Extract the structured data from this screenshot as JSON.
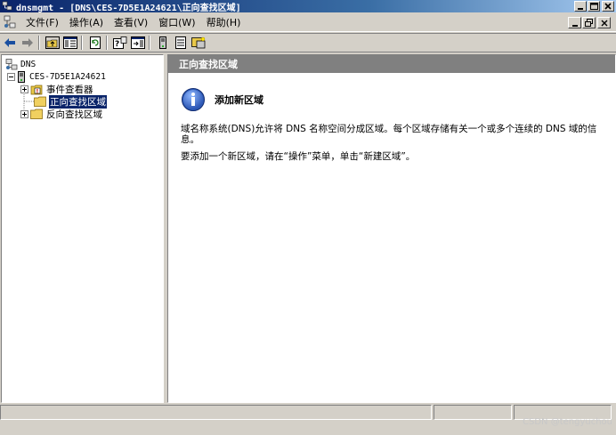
{
  "window": {
    "title": "dnsmgmt - [DNS\\CES-7D5E1A24621\\正向查找区域]"
  },
  "menu": {
    "items": [
      "文件(F)",
      "操作(A)",
      "查看(V)",
      "窗口(W)",
      "帮助(H)"
    ]
  },
  "toolbar": {
    "buttons": [
      "back-icon",
      "forward-icon",
      "up-folder-icon",
      "show-tree-icon",
      "refresh-icon",
      "properties-help-icon",
      "export-icon",
      "server-icon",
      "list-icon",
      "new-zone-icon"
    ]
  },
  "tree": {
    "root": "DNS",
    "server": "CES-7D5E1A24621",
    "items": [
      {
        "label": "事件查看器",
        "selected": false
      },
      {
        "label": "正向查找区域",
        "selected": true
      },
      {
        "label": "反向查找区域",
        "selected": false
      }
    ]
  },
  "content": {
    "header": "正向查找区域",
    "heading": "添加新区域",
    "description": "域名称系统(DNS)允许将 DNS 名称空间分成区域。每个区域存储有关一个或多个连续的 DNS 域的信息。",
    "instruction": "要添加一个新区域，请在“操作”菜单，单击“新建区域”。"
  },
  "watermark": "CSDN @tengyuchou",
  "colors": {
    "title_active": "#0a246a",
    "selection": "#0a246a",
    "face": "#d4d0c8",
    "content_header": "#808080"
  }
}
